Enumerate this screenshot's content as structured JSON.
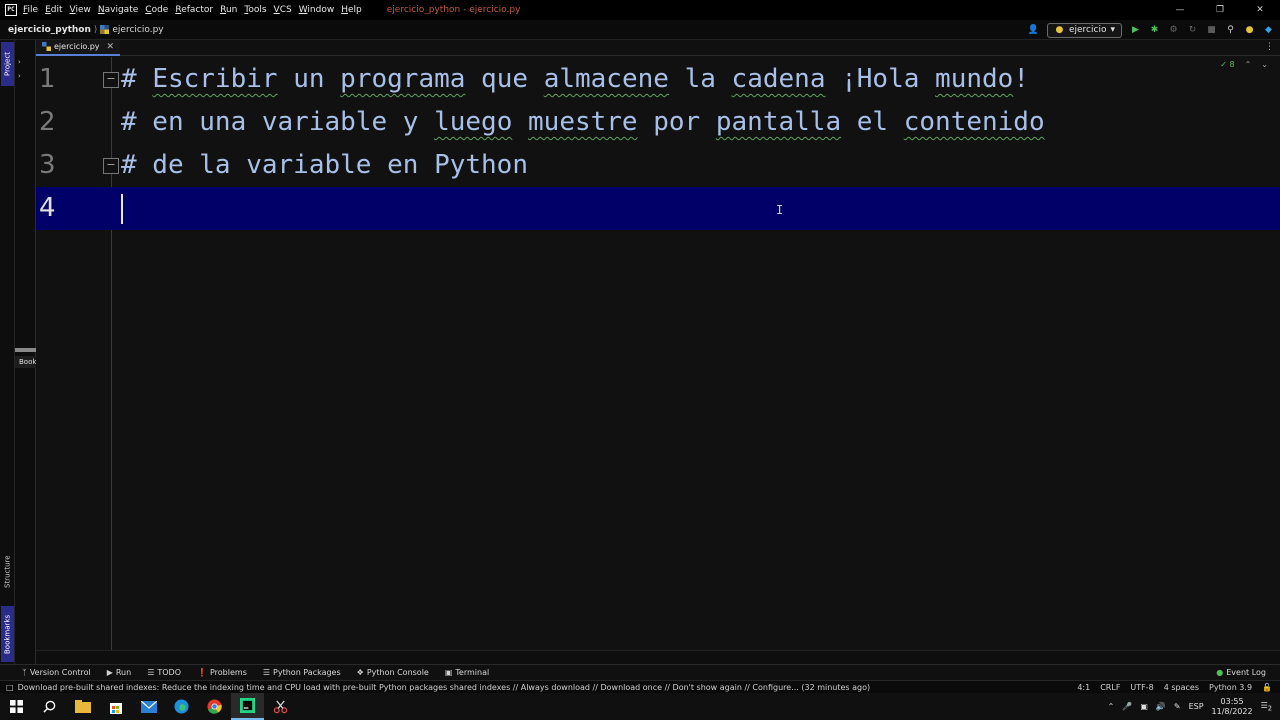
{
  "titlebar": {
    "menu": [
      "File",
      "Edit",
      "View",
      "Navigate",
      "Code",
      "Refactor",
      "Run",
      "Tools",
      "VCS",
      "Window",
      "Help"
    ],
    "window_title": "ejercicio_python - ejercicio.py"
  },
  "navbar": {
    "project": "ejercicio_python",
    "file": "ejercicio.py",
    "run_config": "ejercicio"
  },
  "tabs": [
    {
      "label": "ejercicio.py"
    }
  ],
  "left_panel": {
    "project_tab": "Project",
    "structure_tab": "Structure",
    "bookmarks_tab": "Bookmarks",
    "bookmark_label": "Bookmarks"
  },
  "editor": {
    "inspection_count": "8",
    "lines": [
      {
        "num": "1",
        "code": "# Escribir un programa que almacene la cadena ¡Hola mundo!"
      },
      {
        "num": "2",
        "code": "# en una variable y luego muestre por pantalla el contenido"
      },
      {
        "num": "3",
        "code": "# de la variable en Python"
      },
      {
        "num": "4",
        "code": ""
      }
    ]
  },
  "tool_windows": [
    "Version Control",
    "Run",
    "TODO",
    "Problems",
    "Python Packages",
    "Python Console",
    "Terminal"
  ],
  "event_log": "Event Log",
  "statusbar": {
    "message": "Download pre-built shared indexes: Reduce the indexing time and CPU load with pre-built Python packages shared indexes // Always download // Download once // Don't show again // Configure... (32 minutes ago)",
    "position": "4:1",
    "line_sep": "CRLF",
    "encoding": "UTF-8",
    "indent": "4 spaces",
    "interpreter": "Python 3.9"
  },
  "taskbar": {
    "language": "ESP",
    "time": "03:55",
    "date": "11/8/2022",
    "notifications": "2"
  },
  "colors": {
    "current_line": "#000068",
    "comment_text": "#a8c0e8",
    "accent": "#2b2b8a"
  }
}
